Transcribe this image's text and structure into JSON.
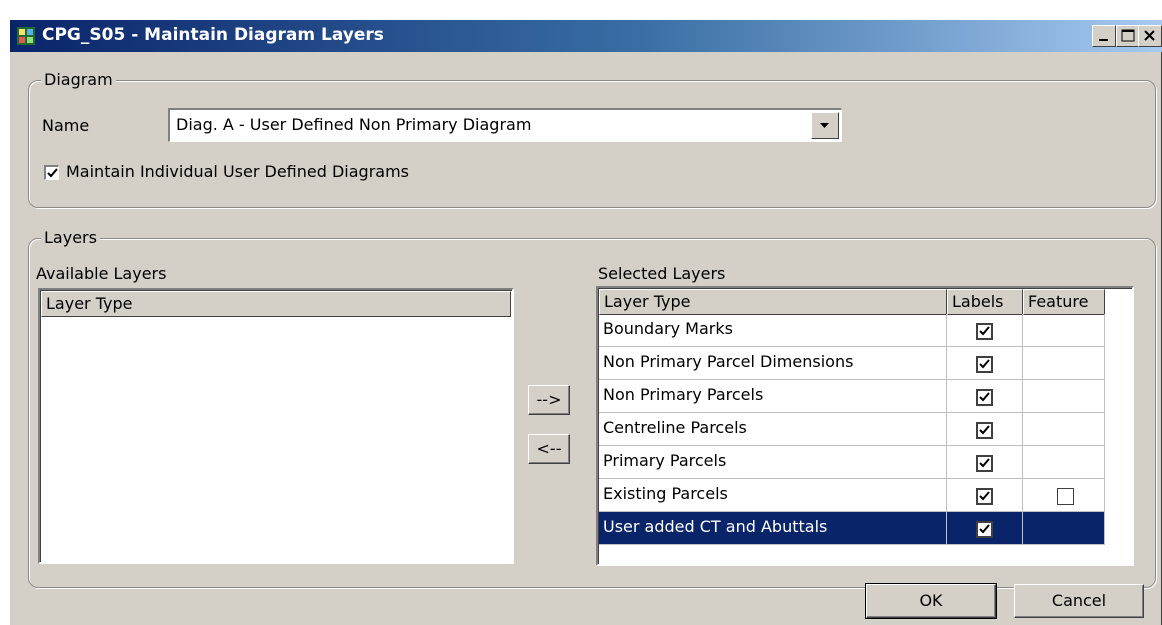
{
  "window": {
    "title": "CPG_S05 - Maintain Diagram Layers"
  },
  "diagram_group": {
    "legend": "Diagram",
    "name_label": "Name",
    "name_value": "Diag. A - User Defined Non Primary Diagram",
    "maintain_checkbox_label": "Maintain Individual User Defined Diagrams",
    "maintain_checked": true
  },
  "layers_group": {
    "legend": "Layers",
    "available_label": "Available Layers",
    "available_columns": [
      "Layer Type"
    ],
    "selected_label": "Selected Layers",
    "selected_columns": [
      "Layer Type",
      "Labels",
      "Feature"
    ],
    "selected_rows": [
      {
        "layer_type": "Boundary Marks",
        "labels": true,
        "feature": null
      },
      {
        "layer_type": "Non Primary Parcel Dimensions",
        "labels": true,
        "feature": null
      },
      {
        "layer_type": "Non Primary Parcels",
        "labels": true,
        "feature": null
      },
      {
        "layer_type": "Centreline Parcels",
        "labels": true,
        "feature": null
      },
      {
        "layer_type": "Primary Parcels",
        "labels": true,
        "feature": null
      },
      {
        "layer_type": "Existing Parcels",
        "labels": true,
        "feature": false
      },
      {
        "layer_type": "User added CT and Abuttals",
        "labels": true,
        "feature": null,
        "selected": true
      }
    ],
    "add_button": "-->",
    "remove_button": "<--"
  },
  "footer": {
    "ok_label": "OK",
    "cancel_label": "Cancel"
  },
  "colors": {
    "titlebar_start": "#0a246a",
    "titlebar_end": "#a6caf0",
    "dialog_face": "#d4d0c8",
    "selection": "#0a246a"
  }
}
